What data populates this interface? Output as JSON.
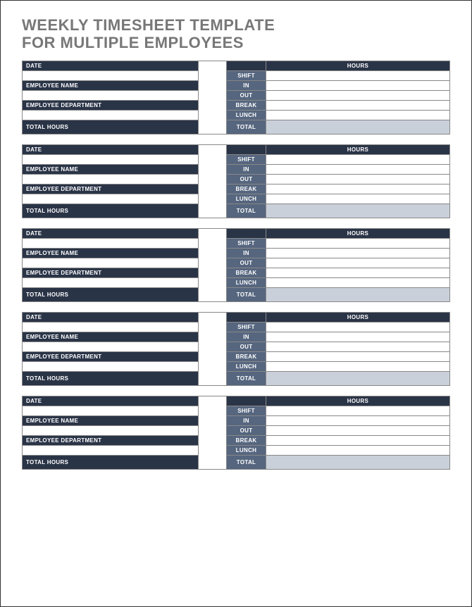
{
  "title_line1": "WEEKLY TIMESHEET TEMPLATE",
  "title_line2": "FOR MULTIPLE EMPLOYEES",
  "labels": {
    "date": "DATE",
    "employee_name": "EMPLOYEE NAME",
    "employee_department": "EMPLOYEE DEPARTMENT",
    "total_hours": "TOTAL HOURS",
    "hours": "HOURS",
    "shift": "SHIFT",
    "in": "IN",
    "out": "OUT",
    "break": "BREAK",
    "lunch": "LUNCH",
    "total": "TOTAL"
  },
  "blocks": [
    {
      "date": "",
      "employee_name": "",
      "employee_department": "",
      "total_hours": "",
      "shift": "",
      "in": "",
      "out": "",
      "break": "",
      "lunch": "",
      "total": ""
    },
    {
      "date": "",
      "employee_name": "",
      "employee_department": "",
      "total_hours": "",
      "shift": "",
      "in": "",
      "out": "",
      "break": "",
      "lunch": "",
      "total": ""
    },
    {
      "date": "",
      "employee_name": "",
      "employee_department": "",
      "total_hours": "",
      "shift": "",
      "in": "",
      "out": "",
      "break": "",
      "lunch": "",
      "total": ""
    },
    {
      "date": "",
      "employee_name": "",
      "employee_department": "",
      "total_hours": "",
      "shift": "",
      "in": "",
      "out": "",
      "break": "",
      "lunch": "",
      "total": ""
    },
    {
      "date": "",
      "employee_name": "",
      "employee_department": "",
      "total_hours": "",
      "shift": "",
      "in": "",
      "out": "",
      "break": "",
      "lunch": "",
      "total": ""
    }
  ]
}
